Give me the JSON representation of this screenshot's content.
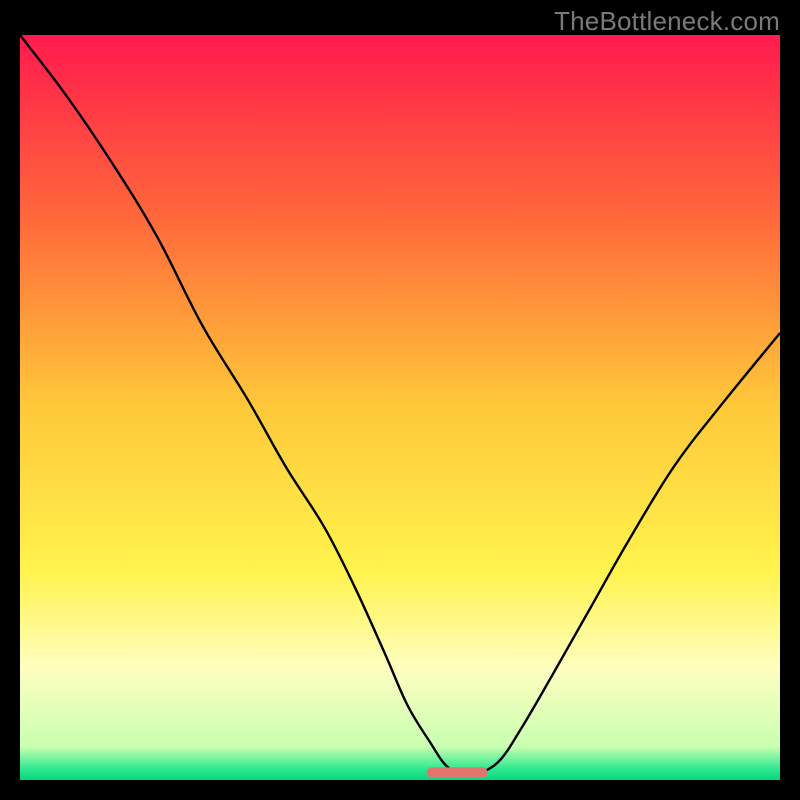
{
  "watermark": "TheBottleneck.com",
  "chart_data": {
    "type": "line",
    "title": "",
    "xlabel": "",
    "ylabel": "",
    "xlim": [
      0,
      100
    ],
    "ylim": [
      0,
      100
    ],
    "grid": false,
    "legend": false,
    "background_gradient": {
      "type": "vertical",
      "stops": [
        {
          "pos": 0.0,
          "color": "#ff1a4d"
        },
        {
          "pos": 0.25,
          "color": "#ff6a3a"
        },
        {
          "pos": 0.5,
          "color": "#ffc93a"
        },
        {
          "pos": 0.72,
          "color": "#fff34d"
        },
        {
          "pos": 0.85,
          "color": "#fffec0"
        },
        {
          "pos": 0.955,
          "color": "#c9ffb0"
        },
        {
          "pos": 0.985,
          "color": "#2ee98f"
        },
        {
          "pos": 1.0,
          "color": "#06d67d"
        }
      ]
    },
    "series": [
      {
        "name": "bottleneck-curve",
        "color": "#000000",
        "stroke_width": 2.4,
        "x": [
          0,
          6,
          12,
          18,
          24,
          30,
          35,
          40,
          44,
          48,
          51,
          54,
          56,
          58,
          60,
          63,
          66,
          70,
          75,
          80,
          86,
          92,
          100
        ],
        "values": [
          100,
          92,
          83,
          73,
          61,
          51,
          42,
          34,
          26,
          17,
          10,
          5,
          2,
          0.8,
          0.8,
          2.5,
          7,
          14,
          23,
          32,
          42,
          50,
          60
        ]
      }
    ],
    "marker": {
      "name": "optimal-range",
      "shape": "rounded-rect",
      "color": "#e0746e",
      "x_center": 57.5,
      "x_width": 8,
      "y": 0.3,
      "height": 1.4
    }
  }
}
